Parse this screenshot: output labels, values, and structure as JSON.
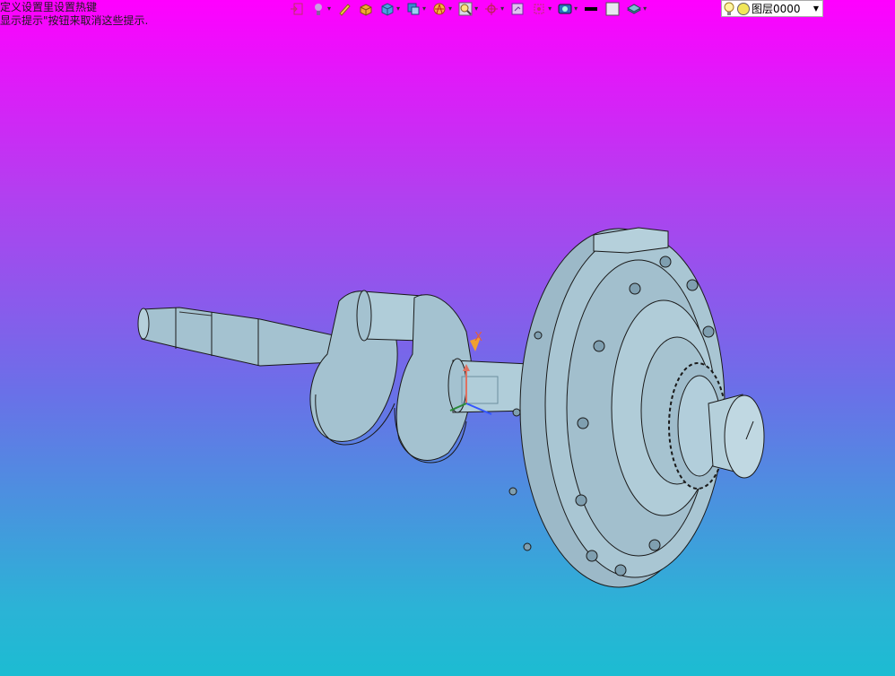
{
  "hints": {
    "line1": "定义设置里设置热键",
    "line2": "显示提示\"按钮来取消这些提示."
  },
  "toolbar": {
    "groups": [
      {
        "name": "exit-sketch",
        "icon": "exit-icon",
        "dropdown": false
      },
      {
        "name": "snap-tools",
        "icon": "snap-icon",
        "dropdown": true
      },
      {
        "name": "pencil",
        "icon": "pencil-icon",
        "dropdown": false
      },
      {
        "name": "solid-box",
        "icon": "box-icon",
        "dropdown": false
      },
      {
        "name": "view-cube",
        "icon": "cube-icon",
        "dropdown": true
      },
      {
        "name": "views",
        "icon": "views-icon",
        "dropdown": true
      },
      {
        "name": "render-style",
        "icon": "render-icon",
        "dropdown": true
      },
      {
        "name": "zoom",
        "icon": "zoom-icon",
        "dropdown": true
      },
      {
        "name": "csys",
        "icon": "csys-icon",
        "dropdown": true
      },
      {
        "name": "select-filter",
        "icon": "filter-icon",
        "dropdown": false
      },
      {
        "name": "snap-point",
        "icon": "snap-point-icon",
        "dropdown": true
      },
      {
        "name": "display-mode",
        "icon": "display-icon",
        "dropdown": true
      },
      {
        "name": "line-color",
        "icon": "line-color-icon",
        "dropdown": false
      },
      {
        "name": "fill-color",
        "icon": "fill-color-icon",
        "dropdown": false
      },
      {
        "name": "layer-tools",
        "icon": "layer-icon",
        "dropdown": true
      }
    ]
  },
  "layer_select": {
    "value": "图层0000"
  },
  "colors": {
    "background_top": "#ff00ff",
    "background_bottom": "#1cbcd2",
    "part": "#9fbdcc",
    "edges": "#1a1a1a"
  },
  "viewport": {
    "triad_label": "X"
  }
}
